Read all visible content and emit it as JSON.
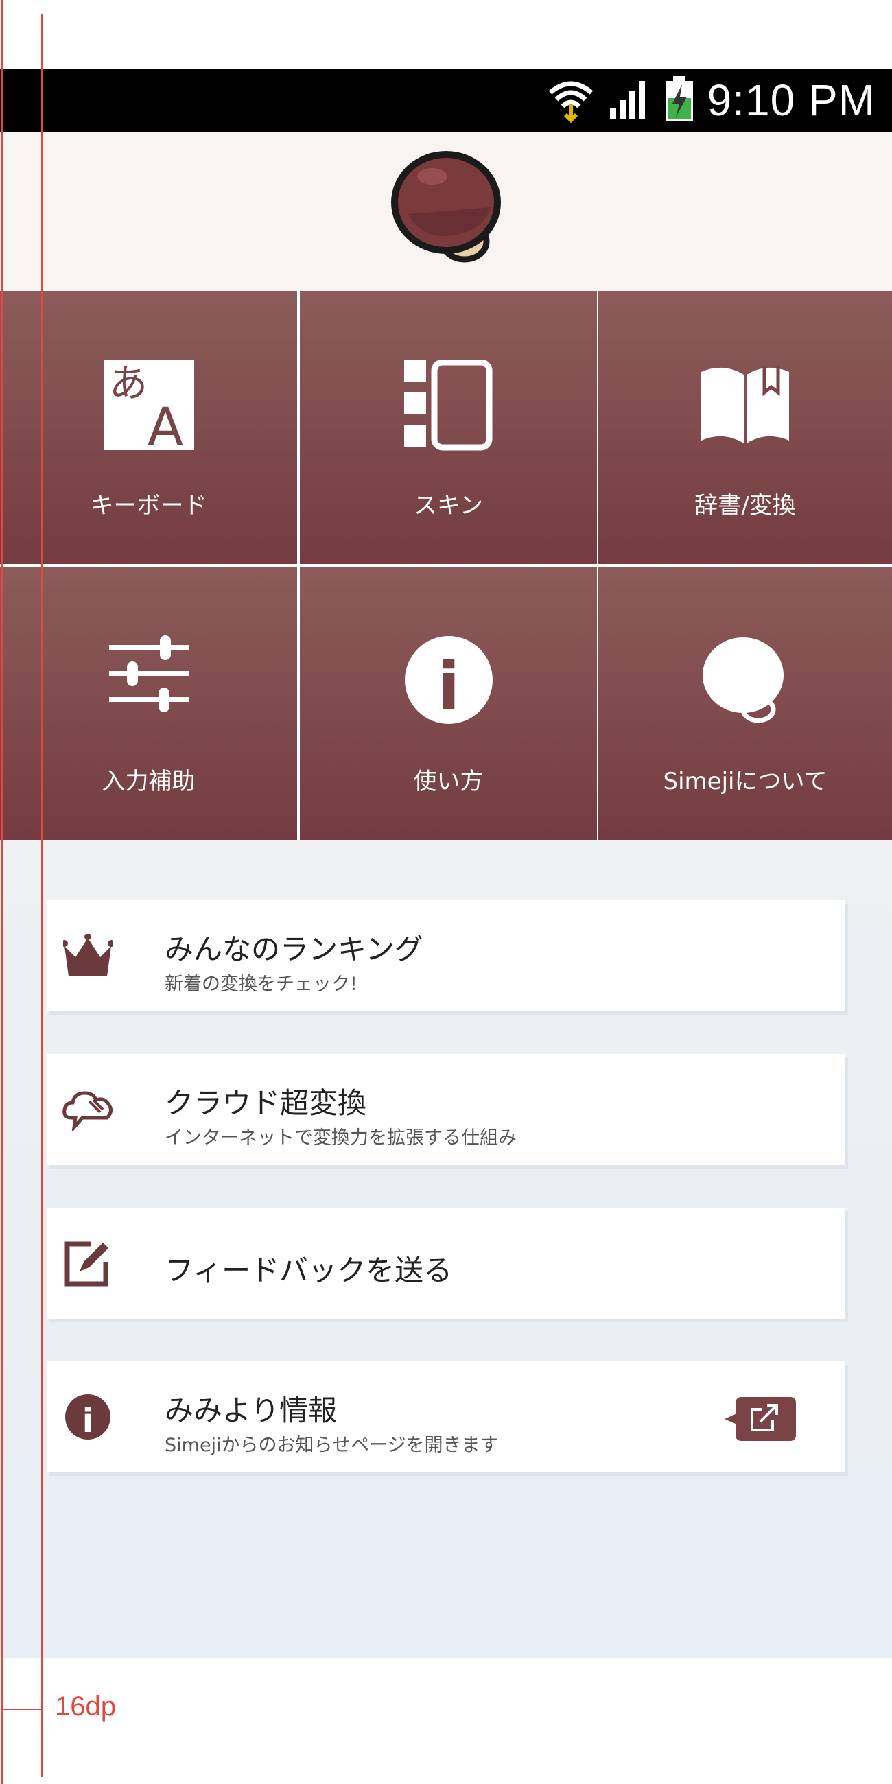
{
  "status_bar": {
    "time": "9:10 PM"
  },
  "tiles": [
    {
      "label": "キーボード",
      "icon": "keyboard-language-icon"
    },
    {
      "label": "スキン",
      "icon": "skin-tablet-icon"
    },
    {
      "label": "辞書/変換",
      "icon": "dictionary-book-icon"
    },
    {
      "label": "入力補助",
      "icon": "input-sliders-icon"
    },
    {
      "label": "使い方",
      "icon": "info-icon"
    },
    {
      "label": "Simejiについて",
      "icon": "simeji-logo-icon"
    }
  ],
  "keyboard_icon": {
    "kana": "あ",
    "latin": "A"
  },
  "info_glyph": "i",
  "cards": [
    {
      "title": "みんなのランキング",
      "subtitle": "新着の変換をチェック!",
      "icon": "crown-icon"
    },
    {
      "title": "クラウド超変換",
      "subtitle": "インターネットで変換力を拡張する仕組み",
      "icon": "cloud-icon"
    },
    {
      "title": "フィードバックを送る",
      "subtitle": "",
      "icon": "edit-icon"
    },
    {
      "title": "みみより情報",
      "subtitle": "Simejiからのお知らせページを開きます",
      "icon": "info-icon"
    }
  ],
  "annotation": {
    "label": "16dp"
  },
  "colors": {
    "brand": "#7a4446",
    "status_bar": "#000000",
    "guide": "#e0473f"
  }
}
